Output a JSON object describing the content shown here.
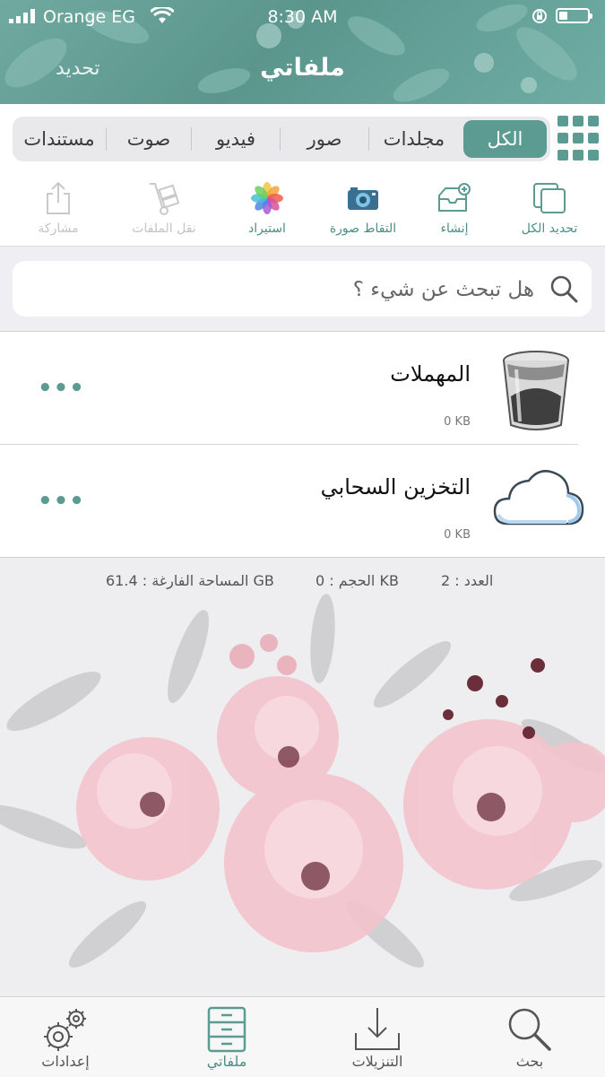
{
  "status_bar": {
    "carrier": "Orange EG",
    "time": "8:30 AM"
  },
  "nav": {
    "title": "ملفاتي",
    "edit_label": "تحديد"
  },
  "filter_tabs": [
    {
      "label": "الكل",
      "active": true
    },
    {
      "label": "مجلدات",
      "active": false
    },
    {
      "label": "صور",
      "active": false
    },
    {
      "label": "فيديو",
      "active": false
    },
    {
      "label": "صوت",
      "active": false
    },
    {
      "label": "مستندات",
      "active": false
    }
  ],
  "toolbar": {
    "select_all": "تحديد الكل",
    "create": "إنشاء",
    "take_photo": "التقاط صورة",
    "import": "استيراد",
    "move_files": "نقل الملفات",
    "share": "مشاركة"
  },
  "search": {
    "placeholder": "هل تبحث عن شيء ؟"
  },
  "items": [
    {
      "name": "المهملات",
      "size": "0 KB",
      "icon": "trash-icon"
    },
    {
      "name": "التخزين السحابي",
      "size": "0 KB",
      "icon": "cloud-icon"
    }
  ],
  "stats": {
    "count": "العدد : 2",
    "size": "الحجم : 0 KB",
    "free_space": "المساحة الفارغة : 61.4 GB"
  },
  "tabbar": [
    {
      "label": "بحث",
      "icon": "search-icon",
      "active": false
    },
    {
      "label": "التنزيلات",
      "icon": "download-icon",
      "active": false
    },
    {
      "label": "ملفاتي",
      "icon": "file-cabinet-icon",
      "active": true
    },
    {
      "label": "إعدادات",
      "icon": "gear-icon",
      "active": false
    }
  ],
  "colors": {
    "accent": "#5b9b92",
    "header": "#5e998f"
  }
}
